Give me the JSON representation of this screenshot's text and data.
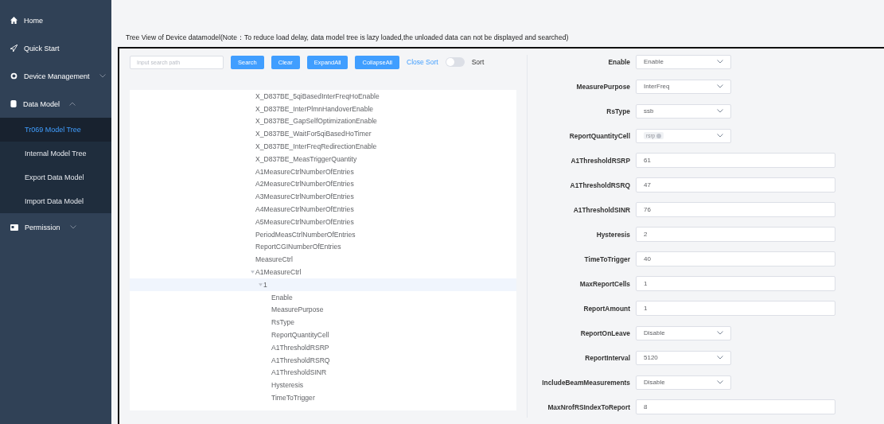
{
  "sidebar": {
    "items": [
      {
        "label": "Home"
      },
      {
        "label": "Quick Start"
      },
      {
        "label": "Device Management",
        "expanded": false
      },
      {
        "label": "Data Model",
        "expanded": true,
        "children": [
          {
            "label": "Tr069 Model Tree",
            "selected": true
          },
          {
            "label": "Internal Model Tree",
            "selected": false
          },
          {
            "label": "Export Data Model",
            "selected": false
          },
          {
            "label": "Import Data Model",
            "selected": false
          }
        ]
      },
      {
        "label": "Permission",
        "expanded": false
      }
    ]
  },
  "description": "Tree View of Device datamodel(Note：To reduce load delay, data model tree is lazy loaded,the unloaded data can not be displayed and searched)",
  "toolbar": {
    "search": {
      "placeholder": "Input search path"
    },
    "buttons": [
      "Search",
      "Clear",
      "ExpandAll",
      "CollapseAll"
    ],
    "sort_left_label": "Close Sort",
    "sort_switch": {
      "on": false
    },
    "sort_right_label": "Sort"
  },
  "tree": [
    {
      "label": "X_D837BE_5qiBasedInterFreqHoEnable",
      "selected": false
    },
    {
      "label": "X_D837BE_InterPlmnHandoverEnable",
      "selected": false
    },
    {
      "label": "X_D837BE_GapSelfOptimizationEnable",
      "selected": false
    },
    {
      "label": "X_D837BE_WaitFor5qiBasedHoTimer",
      "selected": false
    },
    {
      "label": "X_D837BE_InterFreqRedirectionEnable",
      "selected": false
    },
    {
      "label": "X_D837BE_MeasTriggerQuantity",
      "selected": false
    },
    {
      "label": "A1MeasureCtrlNumberOfEntries",
      "selected": false
    },
    {
      "label": "A2MeasureCtrlNumberOfEntries",
      "selected": false
    },
    {
      "label": "A3MeasureCtrlNumberOfEntries",
      "selected": false
    },
    {
      "label": "A4MeasureCtrlNumberOfEntries",
      "selected": false
    },
    {
      "label": "A5MeasureCtrlNumberOfEntries",
      "selected": false
    },
    {
      "label": "PeriodMeasCtrlNumberOfEntries",
      "selected": false
    },
    {
      "label": "ReportCGINumberOfEntries",
      "selected": false
    },
    {
      "label": "MeasureCtrl",
      "selected": false
    },
    {
      "label": "A1MeasureCtrl",
      "selected": false,
      "expanded": true,
      "children": [
        {
          "label": "1",
          "selected": true,
          "expanded": true,
          "children": [
            {
              "label": "Enable",
              "selected": false
            },
            {
              "label": "MeasurePurpose",
              "selected": false
            },
            {
              "label": "RsType",
              "selected": false
            },
            {
              "label": "ReportQuantityCell",
              "selected": false
            },
            {
              "label": "A1ThresholdRSRP",
              "selected": false
            },
            {
              "label": "A1ThresholdRSRQ",
              "selected": false
            },
            {
              "label": "A1ThresholdSINR",
              "selected": false
            },
            {
              "label": "Hysteresis",
              "selected": false
            },
            {
              "label": "TimeToTrigger",
              "selected": false
            }
          ]
        }
      ]
    }
  ],
  "form": [
    {
      "label": "Enable",
      "kind": "select",
      "value": "Enable"
    },
    {
      "label": "MeasurePurpose",
      "kind": "select",
      "value": "InterFreq"
    },
    {
      "label": "RsType",
      "kind": "select",
      "value": "ssb"
    },
    {
      "label": "ReportQuantityCell",
      "kind": "multiselect",
      "tags": [
        "rsrp"
      ]
    },
    {
      "label": "A1ThresholdRSRP",
      "kind": "input",
      "value": "61"
    },
    {
      "label": "A1ThresholdRSRQ",
      "kind": "input",
      "value": "47"
    },
    {
      "label": "A1ThresholdSINR",
      "kind": "input",
      "value": "76"
    },
    {
      "label": "Hysteresis",
      "kind": "input",
      "value": "2"
    },
    {
      "label": "TimeToTrigger",
      "kind": "input",
      "value": "40"
    },
    {
      "label": "MaxReportCells",
      "kind": "input",
      "value": "1"
    },
    {
      "label": "ReportAmount",
      "kind": "input",
      "value": "1"
    },
    {
      "label": "ReportOnLeave",
      "kind": "select",
      "value": "Disable"
    },
    {
      "label": "ReportInterval",
      "kind": "select",
      "value": "5120"
    },
    {
      "label": "IncludeBeamMeasurements",
      "kind": "select",
      "value": "Disable"
    },
    {
      "label": "MaxNrofRSIndexToReport",
      "kind": "input",
      "value": "8"
    }
  ]
}
